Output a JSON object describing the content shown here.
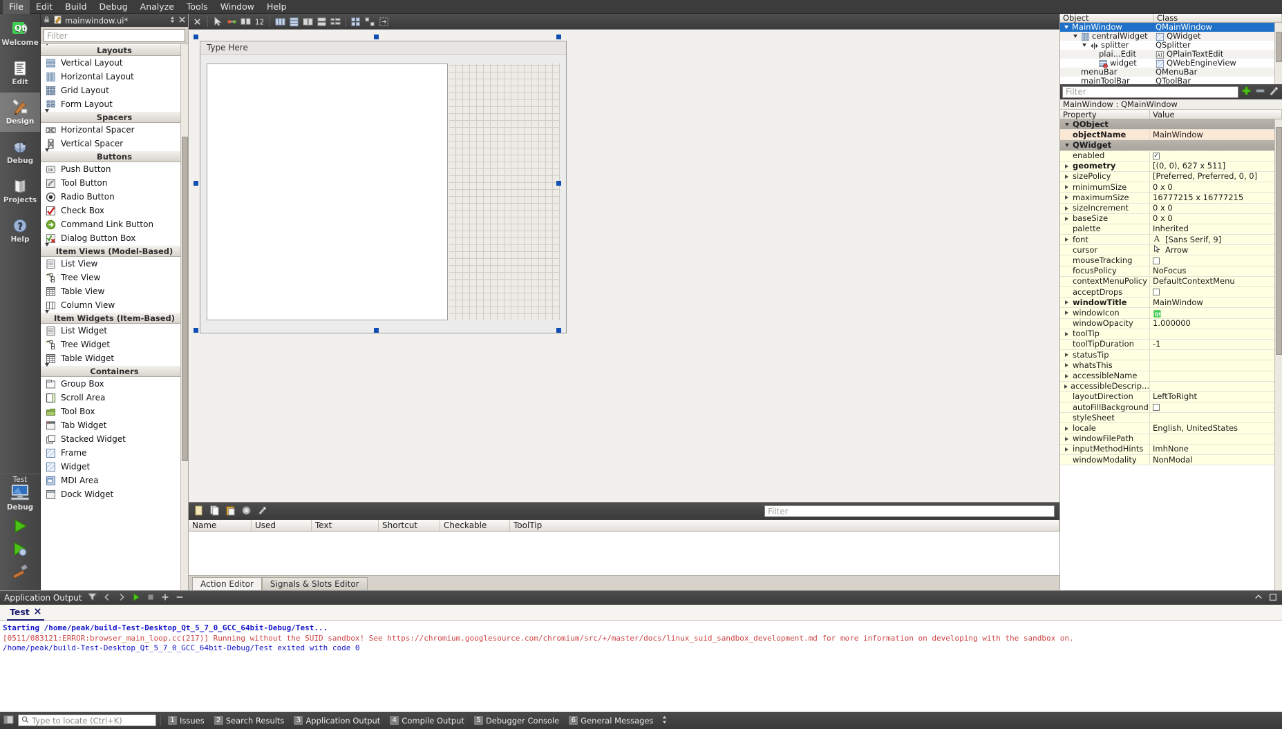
{
  "menubar": {
    "items": [
      "File",
      "Edit",
      "Build",
      "Debug",
      "Analyze",
      "Tools",
      "Window",
      "Help"
    ],
    "active": "File"
  },
  "modes": [
    {
      "label": "Welcome",
      "icon": "qt-logo-icon",
      "selected": false
    },
    {
      "label": "Edit",
      "icon": "document-lines-icon",
      "selected": false
    },
    {
      "label": "Design",
      "icon": "paintbrush-ruler-icon",
      "selected": true
    },
    {
      "label": "Debug",
      "icon": "bug-icon",
      "selected": false
    },
    {
      "label": "Projects",
      "icon": "books-icon",
      "selected": false
    },
    {
      "label": "Help",
      "icon": "question-mark-icon",
      "selected": false
    }
  ],
  "kit_selector": {
    "target": "Test",
    "config": "Debug"
  },
  "run_buttons": [
    {
      "name": "run-button",
      "label": "Run"
    },
    {
      "name": "debug-button",
      "label": "Start Debugging"
    },
    {
      "name": "build-button",
      "label": "Build"
    }
  ],
  "widget_box": {
    "file_tab": {
      "title": "mainwindow.ui*",
      "modified": true
    },
    "filter_placeholder": "Filter",
    "groups": [
      {
        "name": "Layouts",
        "items": [
          {
            "label": "Vertical Layout",
            "icon": "vertical-layout-icon"
          },
          {
            "label": "Horizontal Layout",
            "icon": "horizontal-layout-icon"
          },
          {
            "label": "Grid Layout",
            "icon": "grid-layout-icon"
          },
          {
            "label": "Form Layout",
            "icon": "form-layout-icon"
          }
        ]
      },
      {
        "name": "Spacers",
        "items": [
          {
            "label": "Horizontal Spacer",
            "icon": "horizontal-spacer-icon"
          },
          {
            "label": "Vertical Spacer",
            "icon": "vertical-spacer-icon"
          }
        ]
      },
      {
        "name": "Buttons",
        "items": [
          {
            "label": "Push Button",
            "icon": "push-button-icon"
          },
          {
            "label": "Tool Button",
            "icon": "tool-button-icon"
          },
          {
            "label": "Radio Button",
            "icon": "radio-button-icon"
          },
          {
            "label": "Check Box",
            "icon": "check-box-icon"
          },
          {
            "label": "Command Link Button",
            "icon": "command-link-icon"
          },
          {
            "label": "Dialog Button Box",
            "icon": "dialog-button-box-icon"
          }
        ]
      },
      {
        "name": "Item Views (Model-Based)",
        "items": [
          {
            "label": "List View",
            "icon": "list-view-icon"
          },
          {
            "label": "Tree View",
            "icon": "tree-view-icon"
          },
          {
            "label": "Table View",
            "icon": "table-view-icon"
          },
          {
            "label": "Column View",
            "icon": "column-view-icon"
          }
        ]
      },
      {
        "name": "Item Widgets (Item-Based)",
        "items": [
          {
            "label": "List Widget",
            "icon": "list-widget-icon"
          },
          {
            "label": "Tree Widget",
            "icon": "tree-widget-icon"
          },
          {
            "label": "Table Widget",
            "icon": "table-widget-icon"
          }
        ]
      },
      {
        "name": "Containers",
        "items": [
          {
            "label": "Group Box",
            "icon": "group-box-icon"
          },
          {
            "label": "Scroll Area",
            "icon": "scroll-area-icon"
          },
          {
            "label": "Tool Box",
            "icon": "tool-box-icon"
          },
          {
            "label": "Tab Widget",
            "icon": "tab-widget-icon"
          },
          {
            "label": "Stacked Widget",
            "icon": "stacked-widget-icon"
          },
          {
            "label": "Frame",
            "icon": "frame-icon"
          },
          {
            "label": "Widget",
            "icon": "widget-icon"
          },
          {
            "label": "MDI Area",
            "icon": "mdi-area-icon"
          },
          {
            "label": "Dock Widget",
            "icon": "dock-widget-icon"
          }
        ]
      }
    ]
  },
  "form": {
    "menubar_hint": "Type Here"
  },
  "action_editor": {
    "filter_placeholder": "Filter",
    "columns": [
      "Name",
      "Used",
      "Text",
      "Shortcut",
      "Checkable",
      "ToolTip"
    ],
    "rows": [],
    "tabs": [
      {
        "label": "Action Editor",
        "selected": true
      },
      {
        "label": "Signals & Slots Editor",
        "selected": false
      }
    ]
  },
  "object_inspector": {
    "columns": [
      "Object",
      "Class"
    ],
    "rows": [
      {
        "object": "MainWindow",
        "class": "QMainWindow",
        "depth": 0,
        "expander": "down",
        "icon": "",
        "class_icon": "",
        "selected": true
      },
      {
        "object": "centralWidget",
        "class": "QWidget",
        "depth": 1,
        "expander": "down",
        "icon": "horizontal-layout-icon",
        "class_icon": "widget-icon",
        "selected": false
      },
      {
        "object": "splitter",
        "class": "QSplitter",
        "depth": 2,
        "expander": "down",
        "icon": "splitter-icon",
        "class_icon": "",
        "selected": false
      },
      {
        "object": "plai...Edit",
        "class": "QPlainTextEdit",
        "depth": 3,
        "expander": "none",
        "icon": "",
        "class_icon": "text-edit-icon",
        "selected": false
      },
      {
        "object": "widget",
        "class": "QWebEngineView",
        "depth": 3,
        "expander": "none",
        "icon": "webengine-icon",
        "class_icon": "widget-icon",
        "selected": false
      },
      {
        "object": "menuBar",
        "class": "QMenuBar",
        "depth": 1,
        "expander": "none",
        "icon": "",
        "class_icon": "",
        "selected": false
      },
      {
        "object": "mainToolBar",
        "class": "QToolBar",
        "depth": 1,
        "expander": "none",
        "icon": "",
        "class_icon": "",
        "selected": false
      }
    ]
  },
  "property_editor": {
    "filter_placeholder": "Filter",
    "object_line": "MainWindow : QMainWindow",
    "columns": [
      "Property",
      "Value"
    ],
    "rows": [
      {
        "property": "QObject",
        "value": "",
        "kind": "group",
        "expander": "down"
      },
      {
        "property": "objectName",
        "value": "MainWindow",
        "kind": "peach",
        "expander": "none",
        "bold": true
      },
      {
        "property": "QWidget",
        "value": "",
        "kind": "group",
        "expander": "down"
      },
      {
        "property": "enabled",
        "value": "",
        "kind": "y1",
        "expander": "none",
        "widget": "checkbox-checked"
      },
      {
        "property": "geometry",
        "value": "[(0, 0), 627 x 511]",
        "kind": "y1",
        "expander": "right",
        "bold": true
      },
      {
        "property": "sizePolicy",
        "value": "[Preferred, Preferred, 0, 0]",
        "kind": "y1",
        "expander": "right"
      },
      {
        "property": "minimumSize",
        "value": "0 x 0",
        "kind": "y1",
        "expander": "right"
      },
      {
        "property": "maximumSize",
        "value": "16777215 x 16777215",
        "kind": "y1",
        "expander": "right"
      },
      {
        "property": "sizeIncrement",
        "value": "0 x 0",
        "kind": "y1",
        "expander": "right"
      },
      {
        "property": "baseSize",
        "value": "0 x 0",
        "kind": "y1",
        "expander": "right"
      },
      {
        "property": "palette",
        "value": "Inherited",
        "kind": "y1",
        "expander": "none"
      },
      {
        "property": "font",
        "value": "[Sans Serif, 9]",
        "kind": "y1",
        "expander": "right",
        "widget": "font-icon"
      },
      {
        "property": "cursor",
        "value": "Arrow",
        "kind": "y1",
        "expander": "none",
        "widget": "cursor-icon"
      },
      {
        "property": "mouseTracking",
        "value": "",
        "kind": "y1",
        "expander": "none",
        "widget": "checkbox-unchecked"
      },
      {
        "property": "focusPolicy",
        "value": "NoFocus",
        "kind": "y1",
        "expander": "none"
      },
      {
        "property": "contextMenuPolicy",
        "value": "DefaultContextMenu",
        "kind": "y1",
        "expander": "none"
      },
      {
        "property": "acceptDrops",
        "value": "",
        "kind": "y1",
        "expander": "none",
        "widget": "checkbox-unchecked"
      },
      {
        "property": "windowTitle",
        "value": "MainWindow",
        "kind": "y1",
        "expander": "right",
        "bold": true
      },
      {
        "property": "windowIcon",
        "value": "",
        "kind": "y1",
        "expander": "right",
        "widget": "qt-icon"
      },
      {
        "property": "windowOpacity",
        "value": "1.000000",
        "kind": "y1",
        "expander": "none"
      },
      {
        "property": "toolTip",
        "value": "",
        "kind": "y1",
        "expander": "right"
      },
      {
        "property": "toolTipDuration",
        "value": "-1",
        "kind": "y1",
        "expander": "none"
      },
      {
        "property": "statusTip",
        "value": "",
        "kind": "y1",
        "expander": "right"
      },
      {
        "property": "whatsThis",
        "value": "",
        "kind": "y1",
        "expander": "right"
      },
      {
        "property": "accessibleName",
        "value": "",
        "kind": "y1",
        "expander": "right"
      },
      {
        "property": "accessibleDescrip...",
        "value": "",
        "kind": "y1",
        "expander": "right"
      },
      {
        "property": "layoutDirection",
        "value": "LeftToRight",
        "kind": "y1",
        "expander": "none"
      },
      {
        "property": "autoFillBackground",
        "value": "",
        "kind": "y1",
        "expander": "none",
        "widget": "checkbox-unchecked"
      },
      {
        "property": "styleSheet",
        "value": "",
        "kind": "y1",
        "expander": "none"
      },
      {
        "property": "locale",
        "value": "English, UnitedStates",
        "kind": "y1",
        "expander": "right"
      },
      {
        "property": "windowFilePath",
        "value": "",
        "kind": "y1",
        "expander": "right"
      },
      {
        "property": "inputMethodHints",
        "value": "ImhNone",
        "kind": "y1",
        "expander": "right"
      },
      {
        "property": "windowModality",
        "value": "NonModal",
        "kind": "y1",
        "expander": "none"
      }
    ]
  },
  "output_pane": {
    "title": "Application Output",
    "tab": {
      "label": "Test",
      "closable": true
    },
    "lines": [
      {
        "text": "Starting /home/peak/build-Test-Desktop_Qt_5_7_0_GCC_64bit-Debug/Test...",
        "style": "blue-bold"
      },
      {
        "text": "[0511/083121:ERROR:browser_main_loop.cc(217)] Running without the SUID sandbox! See https://chromium.googlesource.com/chromium/src/+/master/docs/linux_suid_sandbox_development.md for more information on developing with the sandbox on.",
        "style": "red"
      },
      {
        "text": "/home/peak/build-Test-Desktop_Qt_5_7_0_GCC_64bit-Debug/Test exited with code 0",
        "style": "blue"
      }
    ]
  },
  "statusbar": {
    "locator_placeholder": "Type to locate (Ctrl+K)",
    "items": [
      {
        "num": "1",
        "label": "Issues"
      },
      {
        "num": "2",
        "label": "Search Results"
      },
      {
        "num": "3",
        "label": "Application Output"
      },
      {
        "num": "4",
        "label": "Compile Output"
      },
      {
        "num": "5",
        "label": "Debugger Console"
      },
      {
        "num": "6",
        "label": "General Messages"
      }
    ]
  },
  "colors": {
    "selection": "#1e70c8",
    "property_highlight": "#ffffe1",
    "accent_green": "#3fa33f"
  }
}
